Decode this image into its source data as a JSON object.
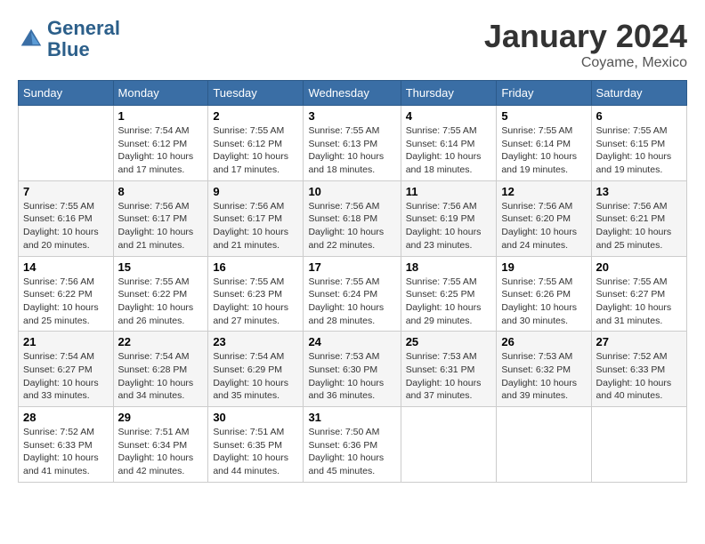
{
  "logo": {
    "line1": "General",
    "line2": "Blue"
  },
  "title": "January 2024",
  "location": "Coyame, Mexico",
  "days_header": [
    "Sunday",
    "Monday",
    "Tuesday",
    "Wednesday",
    "Thursday",
    "Friday",
    "Saturday"
  ],
  "weeks": [
    [
      {
        "day": "",
        "sunrise": "",
        "sunset": "",
        "daylight": ""
      },
      {
        "day": "1",
        "sunrise": "Sunrise: 7:54 AM",
        "sunset": "Sunset: 6:12 PM",
        "daylight": "Daylight: 10 hours and 17 minutes."
      },
      {
        "day": "2",
        "sunrise": "Sunrise: 7:55 AM",
        "sunset": "Sunset: 6:12 PM",
        "daylight": "Daylight: 10 hours and 17 minutes."
      },
      {
        "day": "3",
        "sunrise": "Sunrise: 7:55 AM",
        "sunset": "Sunset: 6:13 PM",
        "daylight": "Daylight: 10 hours and 18 minutes."
      },
      {
        "day": "4",
        "sunrise": "Sunrise: 7:55 AM",
        "sunset": "Sunset: 6:14 PM",
        "daylight": "Daylight: 10 hours and 18 minutes."
      },
      {
        "day": "5",
        "sunrise": "Sunrise: 7:55 AM",
        "sunset": "Sunset: 6:14 PM",
        "daylight": "Daylight: 10 hours and 19 minutes."
      },
      {
        "day": "6",
        "sunrise": "Sunrise: 7:55 AM",
        "sunset": "Sunset: 6:15 PM",
        "daylight": "Daylight: 10 hours and 19 minutes."
      }
    ],
    [
      {
        "day": "7",
        "sunrise": "Sunrise: 7:55 AM",
        "sunset": "Sunset: 6:16 PM",
        "daylight": "Daylight: 10 hours and 20 minutes."
      },
      {
        "day": "8",
        "sunrise": "Sunrise: 7:56 AM",
        "sunset": "Sunset: 6:17 PM",
        "daylight": "Daylight: 10 hours and 21 minutes."
      },
      {
        "day": "9",
        "sunrise": "Sunrise: 7:56 AM",
        "sunset": "Sunset: 6:17 PM",
        "daylight": "Daylight: 10 hours and 21 minutes."
      },
      {
        "day": "10",
        "sunrise": "Sunrise: 7:56 AM",
        "sunset": "Sunset: 6:18 PM",
        "daylight": "Daylight: 10 hours and 22 minutes."
      },
      {
        "day": "11",
        "sunrise": "Sunrise: 7:56 AM",
        "sunset": "Sunset: 6:19 PM",
        "daylight": "Daylight: 10 hours and 23 minutes."
      },
      {
        "day": "12",
        "sunrise": "Sunrise: 7:56 AM",
        "sunset": "Sunset: 6:20 PM",
        "daylight": "Daylight: 10 hours and 24 minutes."
      },
      {
        "day": "13",
        "sunrise": "Sunrise: 7:56 AM",
        "sunset": "Sunset: 6:21 PM",
        "daylight": "Daylight: 10 hours and 25 minutes."
      }
    ],
    [
      {
        "day": "14",
        "sunrise": "Sunrise: 7:56 AM",
        "sunset": "Sunset: 6:22 PM",
        "daylight": "Daylight: 10 hours and 25 minutes."
      },
      {
        "day": "15",
        "sunrise": "Sunrise: 7:55 AM",
        "sunset": "Sunset: 6:22 PM",
        "daylight": "Daylight: 10 hours and 26 minutes."
      },
      {
        "day": "16",
        "sunrise": "Sunrise: 7:55 AM",
        "sunset": "Sunset: 6:23 PM",
        "daylight": "Daylight: 10 hours and 27 minutes."
      },
      {
        "day": "17",
        "sunrise": "Sunrise: 7:55 AM",
        "sunset": "Sunset: 6:24 PM",
        "daylight": "Daylight: 10 hours and 28 minutes."
      },
      {
        "day": "18",
        "sunrise": "Sunrise: 7:55 AM",
        "sunset": "Sunset: 6:25 PM",
        "daylight": "Daylight: 10 hours and 29 minutes."
      },
      {
        "day": "19",
        "sunrise": "Sunrise: 7:55 AM",
        "sunset": "Sunset: 6:26 PM",
        "daylight": "Daylight: 10 hours and 30 minutes."
      },
      {
        "day": "20",
        "sunrise": "Sunrise: 7:55 AM",
        "sunset": "Sunset: 6:27 PM",
        "daylight": "Daylight: 10 hours and 31 minutes."
      }
    ],
    [
      {
        "day": "21",
        "sunrise": "Sunrise: 7:54 AM",
        "sunset": "Sunset: 6:27 PM",
        "daylight": "Daylight: 10 hours and 33 minutes."
      },
      {
        "day": "22",
        "sunrise": "Sunrise: 7:54 AM",
        "sunset": "Sunset: 6:28 PM",
        "daylight": "Daylight: 10 hours and 34 minutes."
      },
      {
        "day": "23",
        "sunrise": "Sunrise: 7:54 AM",
        "sunset": "Sunset: 6:29 PM",
        "daylight": "Daylight: 10 hours and 35 minutes."
      },
      {
        "day": "24",
        "sunrise": "Sunrise: 7:53 AM",
        "sunset": "Sunset: 6:30 PM",
        "daylight": "Daylight: 10 hours and 36 minutes."
      },
      {
        "day": "25",
        "sunrise": "Sunrise: 7:53 AM",
        "sunset": "Sunset: 6:31 PM",
        "daylight": "Daylight: 10 hours and 37 minutes."
      },
      {
        "day": "26",
        "sunrise": "Sunrise: 7:53 AM",
        "sunset": "Sunset: 6:32 PM",
        "daylight": "Daylight: 10 hours and 39 minutes."
      },
      {
        "day": "27",
        "sunrise": "Sunrise: 7:52 AM",
        "sunset": "Sunset: 6:33 PM",
        "daylight": "Daylight: 10 hours and 40 minutes."
      }
    ],
    [
      {
        "day": "28",
        "sunrise": "Sunrise: 7:52 AM",
        "sunset": "Sunset: 6:33 PM",
        "daylight": "Daylight: 10 hours and 41 minutes."
      },
      {
        "day": "29",
        "sunrise": "Sunrise: 7:51 AM",
        "sunset": "Sunset: 6:34 PM",
        "daylight": "Daylight: 10 hours and 42 minutes."
      },
      {
        "day": "30",
        "sunrise": "Sunrise: 7:51 AM",
        "sunset": "Sunset: 6:35 PM",
        "daylight": "Daylight: 10 hours and 44 minutes."
      },
      {
        "day": "31",
        "sunrise": "Sunrise: 7:50 AM",
        "sunset": "Sunset: 6:36 PM",
        "daylight": "Daylight: 10 hours and 45 minutes."
      },
      {
        "day": "",
        "sunrise": "",
        "sunset": "",
        "daylight": ""
      },
      {
        "day": "",
        "sunrise": "",
        "sunset": "",
        "daylight": ""
      },
      {
        "day": "",
        "sunrise": "",
        "sunset": "",
        "daylight": ""
      }
    ]
  ]
}
